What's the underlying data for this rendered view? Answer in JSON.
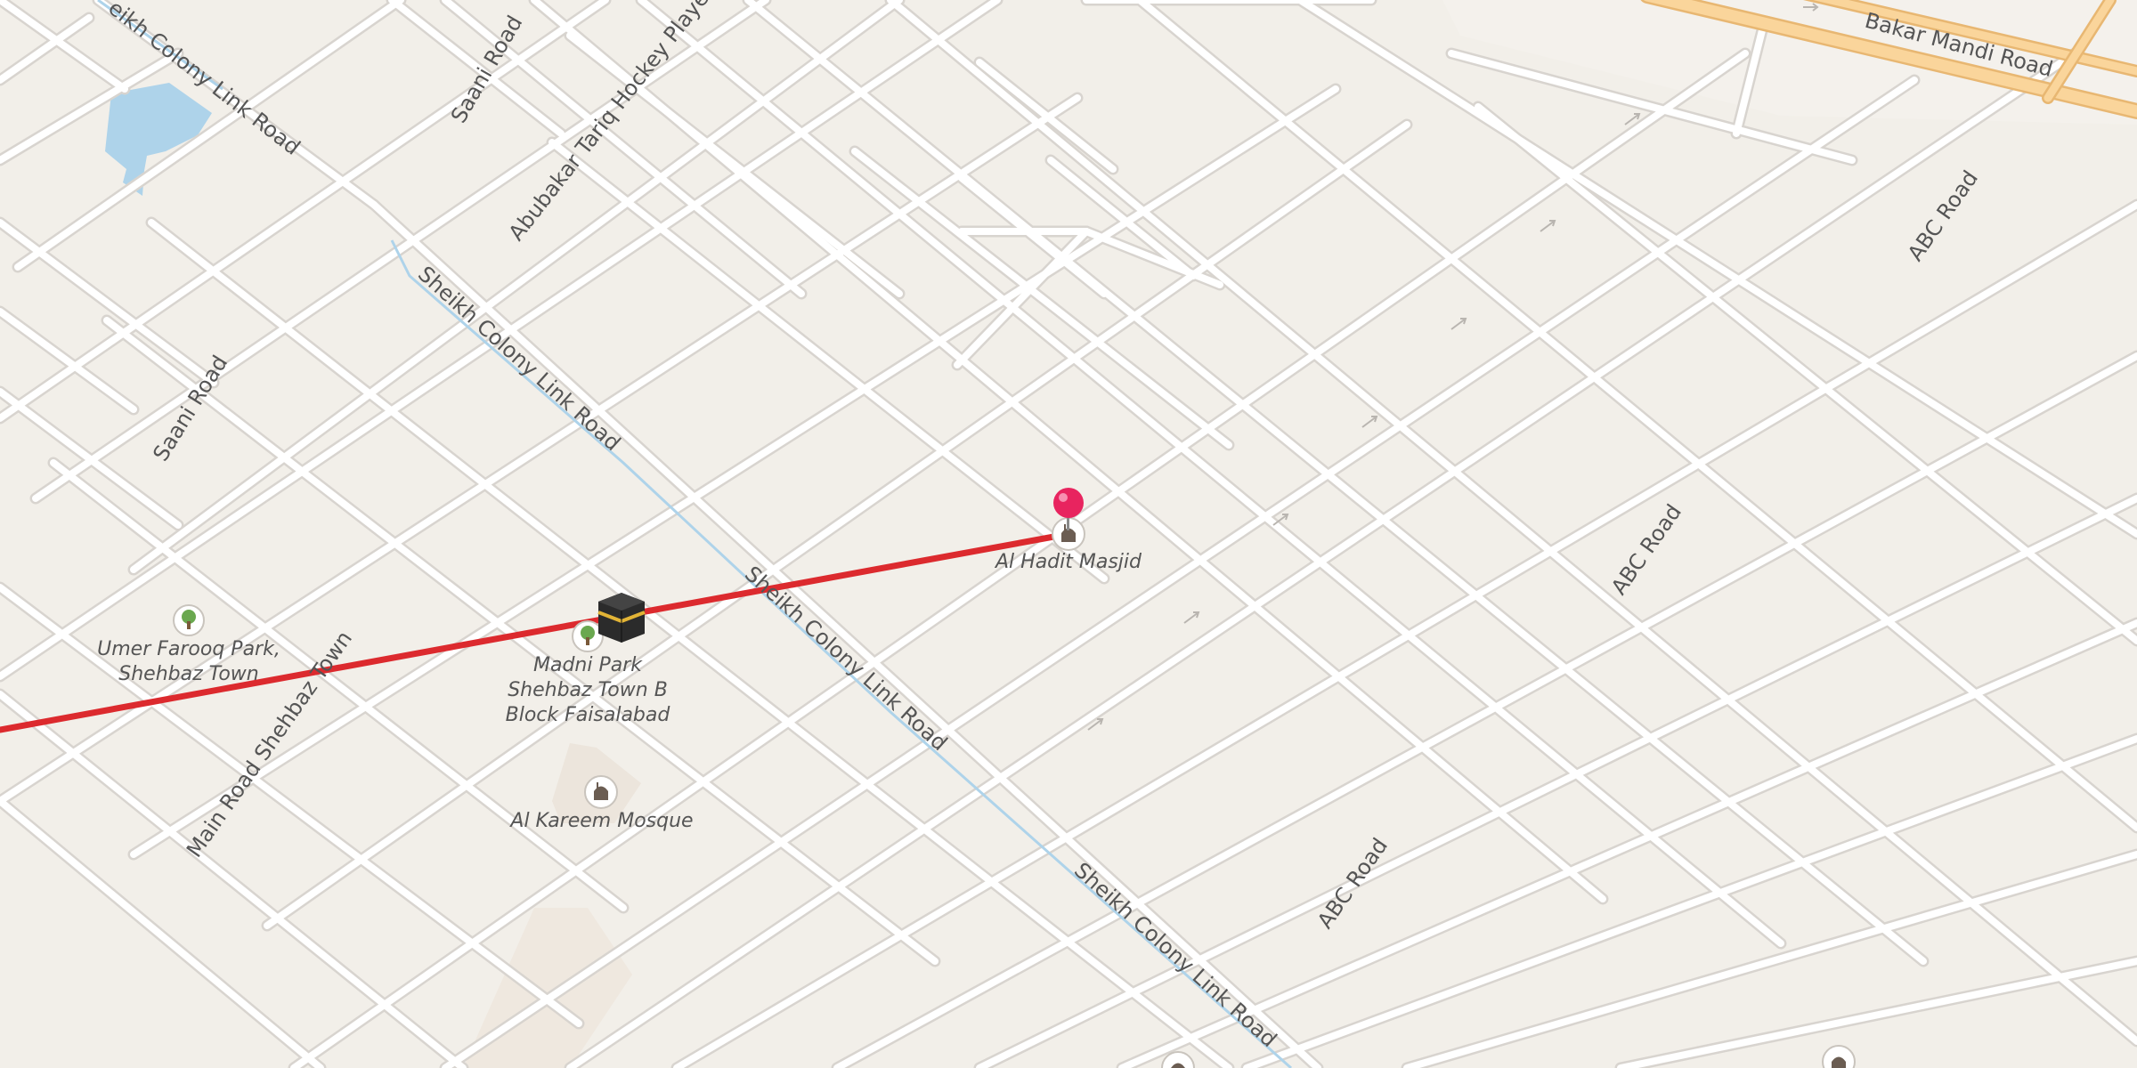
{
  "roads": {
    "saani_road_north": "Saani Road",
    "saani_road_west": "Saani Road",
    "abubakar_road": "Abubakar Tariq Hockey Player S",
    "sheikh_colony_top": "eikh Colony Link Road",
    "sheikh_colony_1": "Sheikh Colony Link Road",
    "sheikh_colony_2": "Sheikh Colony Link Road",
    "sheikh_colony_3": "Sheikh Colony Link Road",
    "bakar_mandi": "Bakar Mandi Road",
    "abc_road_1": "ABC Road",
    "abc_road_2": "ABC Road",
    "abc_road_3": "ABC Road",
    "main_road_shehbaz": "Main Road Shehbaz Town"
  },
  "pois": {
    "al_hadit": "Al Hadit Masjid",
    "umer_farooq_1": "Umer Farooq Park,",
    "umer_farooq_2": "Shehbaz Town",
    "madni_1": "Madni Park",
    "madni_2": "Shehbaz Town B",
    "madni_3": "Block Faisalabad",
    "al_kareem": "Al Kareem Mosque"
  },
  "colors": {
    "land": "#f2efe9",
    "road": "#ffffff",
    "road_casing": "#d8d4cf",
    "major_road": "#fad59b",
    "water": "#aed3ea",
    "route": "#dc2a2e",
    "pin": "#e8245f"
  },
  "icons": {
    "pin": "map-pin-icon",
    "kaaba": "kaaba-icon",
    "mosque": "mosque-icon",
    "park": "tree-icon"
  }
}
